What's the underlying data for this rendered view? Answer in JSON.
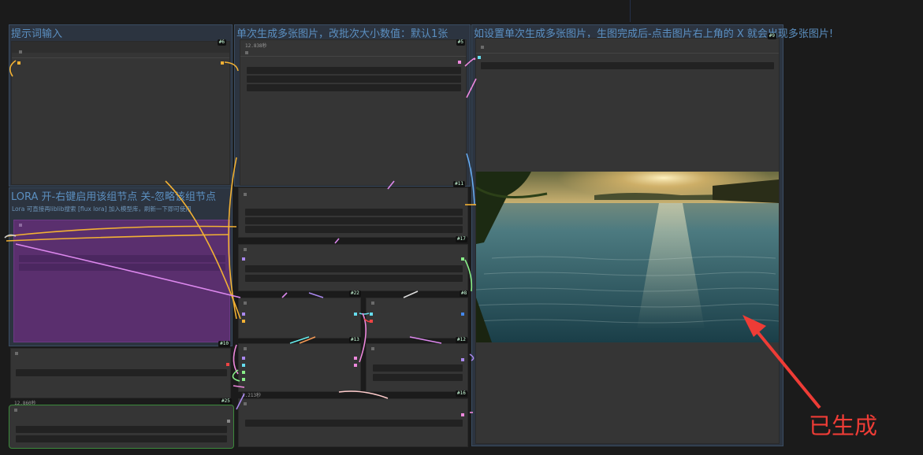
{
  "groups": {
    "prompt": {
      "title": "提示词输入"
    },
    "batch": {
      "title": "单次生成多张图片，改批次大小数值：默认1张"
    },
    "preview": {
      "title": "如设置单次生成多张图片，生图完成后-点击图片右上角的 X 就会出现多张图片!"
    },
    "lora": {
      "title": "LORA  开-右键启用该组节点  关-忽略该组节点",
      "subtitle": "Lora 可直接再liblib搜索 [flux lora] 加入模型库，刷新一下即可使用"
    }
  },
  "badges": {
    "n6a": "#6",
    "n5": "#5",
    "n9": "#9",
    "n11": "#11",
    "n17": "#17",
    "n22": "#22",
    "n8": "#8",
    "n10": "#10",
    "n13": "#13",
    "n12": "#12",
    "n16": "#16",
    "n25": "#25"
  },
  "timings": {
    "t1": "12.838秒",
    "t2": "12.860秒",
    "t3": "3.213秒"
  },
  "annotation": {
    "label": "已生成",
    "color": "#ee3c36"
  },
  "colors": {
    "accent": "#5b8fc0",
    "lora_fill": "#5a2f6e",
    "group_bg": "#2c3440"
  }
}
